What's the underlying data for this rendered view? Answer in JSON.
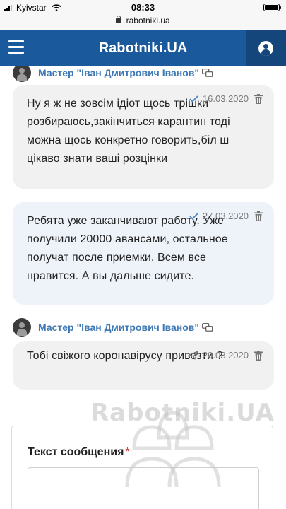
{
  "status_bar": {
    "carrier": "Kyivstar",
    "time": "08:33",
    "battery_level": 0.9
  },
  "browser": {
    "url": "rabotniki.ua"
  },
  "header": {
    "title": "Rabotniki.UA",
    "menu_icon": "hamburger-icon",
    "user_icon": "user-icon"
  },
  "messages": [
    {
      "author": "Мастер \"Іван Дмитрович Іванов\"",
      "text": "Ну я ж не зовсім ідіот щось трішки розбираюсь,закінчиться карантин тоді можна щось конкретно говорить,біл ш цікаво знати ваші розцінки",
      "date": "16.03.2020",
      "status_icon": "check-icon"
    },
    {
      "author": "",
      "text": "Ребята уже заканчивают работу. Уже получили 20000 авансами, остальное получат после приемки. Всем все нравится. А вы дальше сидите.",
      "date": "27.03.2020",
      "status_icon": "check-icon"
    },
    {
      "author": "Мастер \"Іван Дмитрович Іванов\"",
      "text": "Тобі свіжого коронавірусу привезти ?",
      "date": "29.03.2020",
      "status_icon": "sent-icon"
    }
  ],
  "form": {
    "label": "Текст сообщения",
    "required_mark": "*"
  },
  "watermark": {
    "text": "Rabotniki.UA"
  },
  "colors": {
    "header_bg": "#1a5a9c",
    "author_link": "#3e79b5",
    "incoming_bubble": "#f1f1f1",
    "outgoing_bubble": "#eef3fa",
    "check": "#4a86c5"
  }
}
